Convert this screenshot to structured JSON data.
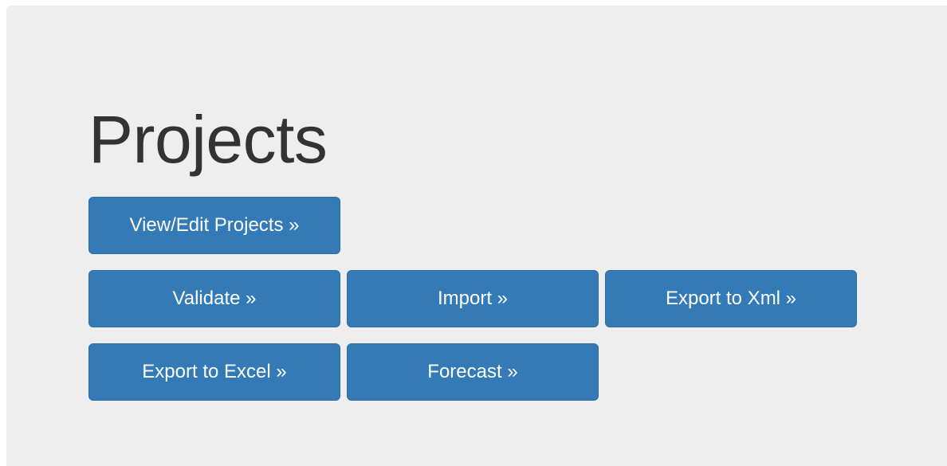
{
  "jumbotron": {
    "title": "Projects",
    "background_color": "#eeeeee",
    "button_color": "#337ab7",
    "buttons": {
      "view_edit_projects": "View/Edit Projects »",
      "validate": "Validate »",
      "import": "Import »",
      "export_xml": "Export to Xml »",
      "export_excel": "Export to Excel »",
      "forecast": "Forecast »"
    }
  }
}
